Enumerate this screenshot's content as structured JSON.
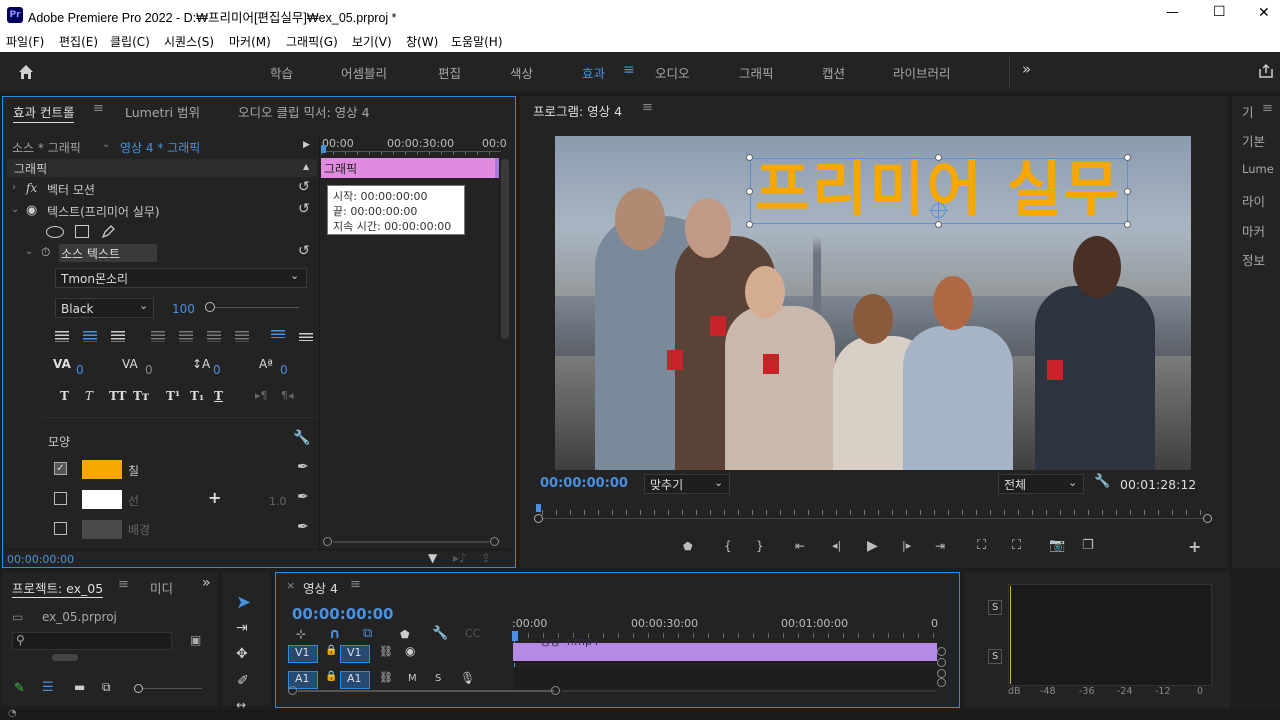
{
  "window": {
    "app_icon": "Pr",
    "title": "Adobe Premiere Pro 2022 - D:₩프리미어[편집실무]₩ex_05.prproj *",
    "controls": {
      "minimize": "—",
      "maximize": "☐",
      "close": "✕"
    }
  },
  "menu": [
    "파일(F)",
    "편집(E)",
    "클립(C)",
    "시퀀스(S)",
    "마커(M)",
    "그래픽(G)",
    "보기(V)",
    "창(W)",
    "도움말(H)"
  ],
  "workspaces": {
    "tabs": [
      "학습",
      "어셈블리",
      "편집",
      "색상",
      "효과",
      "오디오",
      "그래픽",
      "캡션",
      "라이브러리"
    ],
    "active": "효과",
    "more": "»"
  },
  "effect_controls": {
    "tabs": [
      "효과 컨트롤",
      "Lumetri 범위",
      "오디오 클립 믹서: 영상 4"
    ],
    "source": "소스 * 그래픽",
    "sequence": "영상 4 * 그래픽",
    "ruler": [
      "00:00",
      "00:00:30:00",
      "00:0"
    ],
    "clip_label": "그래픽",
    "tooltip": {
      "start": "시작: 00:00:00:00",
      "end": "끝: 00:00:00:00",
      "duration": "지속 시간: 00:00:00:00"
    },
    "section": "그래픽",
    "vector_motion": "벡터 모션",
    "text_layer": "텍스트(프리미어 실무)",
    "source_text": "소스 텍스트",
    "font": "Tmon몬소리",
    "font_style": "Black",
    "font_size": "100",
    "tracking": [
      "0",
      "0",
      "0",
      "0"
    ],
    "appearance": "모양",
    "fill": {
      "label": "칠",
      "color": "#f6a800",
      "checked": true
    },
    "stroke": {
      "label": "선",
      "color": "#ffffff",
      "checked": false,
      "width": "1.0"
    },
    "background": {
      "label": "배경",
      "checked": false
    },
    "timecode": "00:00:00:00"
  },
  "program": {
    "title": "프로그램: 영상 4",
    "overlay_text": "프리미어 실무",
    "timecode": "00:00:00:00",
    "zoom": "맞추기",
    "quality": "전체",
    "duration": "00:01:28:12"
  },
  "right_panel": [
    "기",
    "기본",
    "Lume",
    "라이",
    "마커",
    "정보"
  ],
  "project": {
    "tabs": [
      "프로젝트: ex_05",
      "미디"
    ],
    "file": "ex_05.prproj"
  },
  "timeline": {
    "title": "영상 4",
    "timecode": "00:00:00:00",
    "ruler": [
      ":00:00",
      "00:00:30:00",
      "00:01:00:00",
      "0"
    ],
    "tracks": {
      "v1_src": "V1",
      "v1": "V1",
      "a1_src": "A1",
      "a1": "A1",
      "m": "M",
      "s": "S"
    },
    "clip": "영상 4.mp4"
  },
  "audio_meter": {
    "s_labels": [
      "S",
      "S"
    ],
    "scale": [
      "dB",
      "-48",
      "-36",
      "-24",
      "-12",
      "0"
    ]
  },
  "colors": {
    "accent_blue": "#4a90e2",
    "graphic_clip": "#e08be0",
    "video_clip": "#b48ae6",
    "panel_bg": "#232323",
    "title_text": "#f6a800"
  }
}
